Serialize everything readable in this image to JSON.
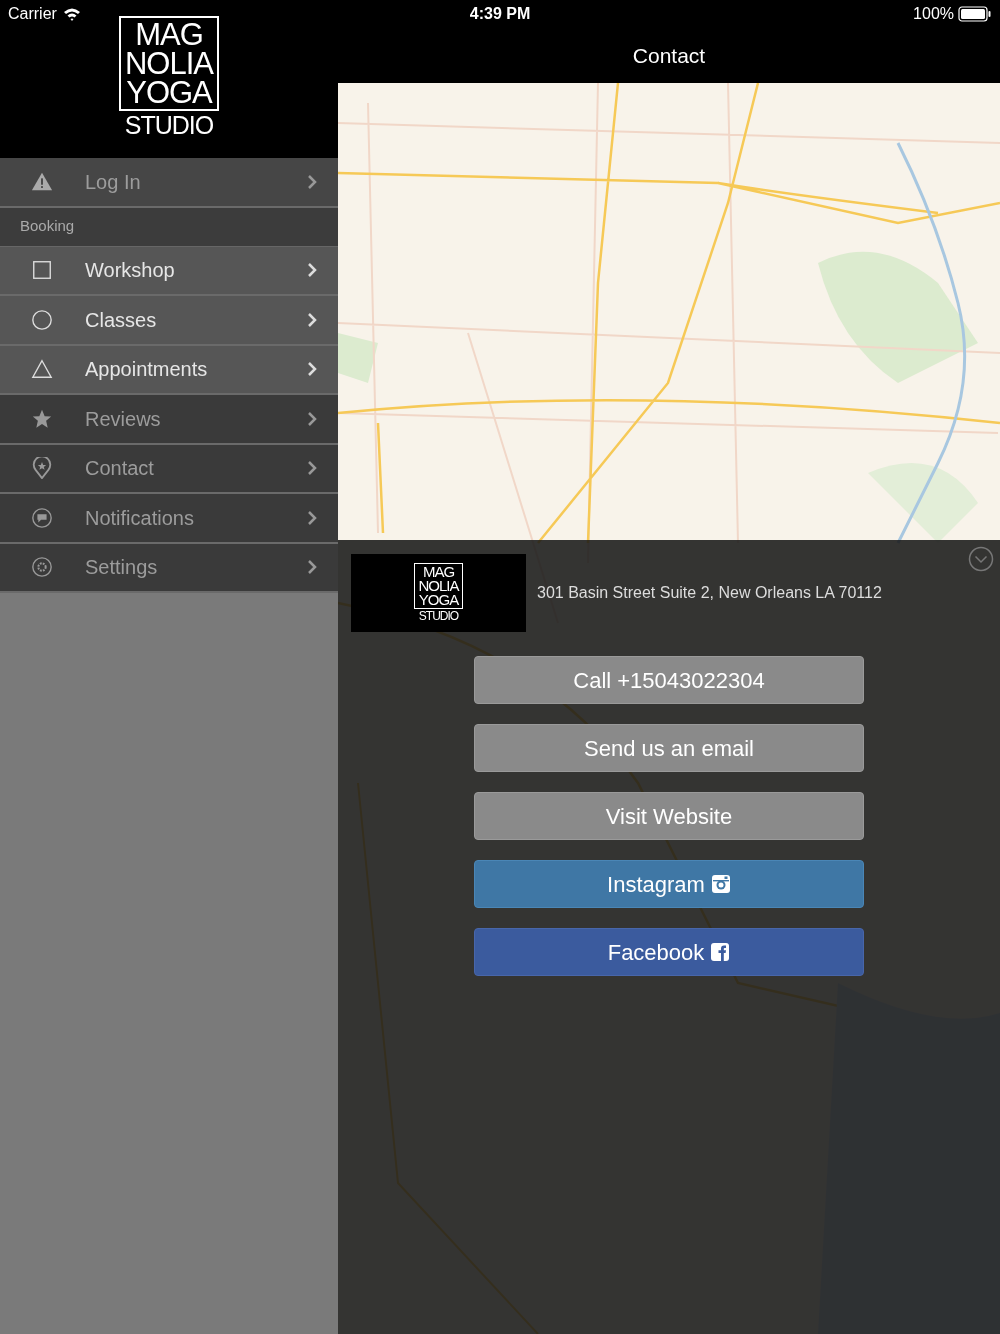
{
  "status_bar": {
    "carrier": "Carrier",
    "time": "4:39 PM",
    "battery": "100%"
  },
  "logo": {
    "lines": [
      "MAG",
      "NOLIA",
      "YOGA",
      "STUDIO"
    ]
  },
  "menu": [
    {
      "kind": "item",
      "label": "Log In",
      "disabled": true
    },
    {
      "kind": "section",
      "label": "Booking"
    },
    {
      "kind": "item",
      "label": "Workshop",
      "disabled": false
    },
    {
      "kind": "item",
      "label": "Classes",
      "disabled": false
    },
    {
      "kind": "item",
      "label": "Appointments",
      "disabled": false
    },
    {
      "kind": "item",
      "label": "Reviews",
      "disabled": true
    },
    {
      "kind": "item",
      "label": "Contact",
      "disabled": true
    },
    {
      "kind": "item",
      "label": "Notifications",
      "disabled": true
    },
    {
      "kind": "item",
      "label": "Settings",
      "disabled": true
    }
  ],
  "header": {
    "title": "Contact"
  },
  "card": {
    "logo_lines": [
      "MAG",
      "NOLIA",
      "YOGA",
      "STUDIO"
    ],
    "address": "301 Basin Street Suite 2, New Orleans LA 70112"
  },
  "buttons": [
    {
      "kind": "plain",
      "label": "Call +15043022304"
    },
    {
      "kind": "plain",
      "label": "Send us an email"
    },
    {
      "kind": "plain",
      "label": "Visit Website"
    },
    {
      "kind": "instagram",
      "label": "Instagram"
    },
    {
      "kind": "facebook",
      "label": "Facebook"
    }
  ]
}
